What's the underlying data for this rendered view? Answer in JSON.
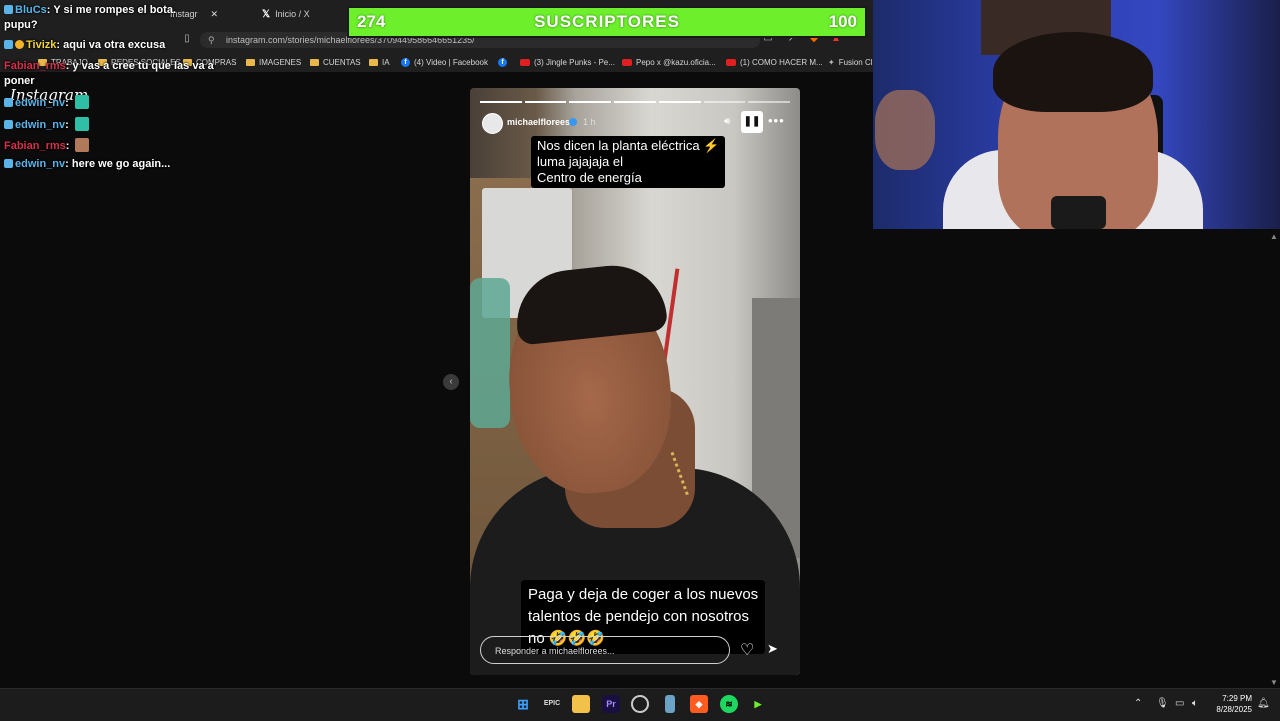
{
  "browser": {
    "tabs": [
      {
        "label": "Instagr"
      },
      {
        "label": "Inicio / X"
      }
    ],
    "url": "instagram.com/stories/michaelflorees/3709449586646651235/",
    "bookmarks": [
      {
        "label": "TRABAJO",
        "icon": "folder-icon"
      },
      {
        "label": "REDES SOCIALES",
        "icon": "folder-icon"
      },
      {
        "label": "COMPRAS",
        "icon": "folder-icon"
      },
      {
        "label": "IMAGENES",
        "icon": "folder-icon"
      },
      {
        "label": "CUENTAS",
        "icon": "folder-icon"
      },
      {
        "label": "IA",
        "icon": "folder-icon"
      },
      {
        "label": "(4) Video | Facebook",
        "icon": "facebook-icon"
      },
      {
        "label": "(3) Jingle Punks - Pe...",
        "icon": "youtube-icon"
      },
      {
        "label": "Pepo x @kazu.oficia...",
        "icon": "youtube-icon"
      },
      {
        "label": "(1) COMO HACER M...",
        "icon": "youtube-icon"
      },
      {
        "label": "Fusion Cl",
        "icon": "app-icon"
      }
    ]
  },
  "instagram": {
    "logo": "Instagram",
    "story": {
      "username": "michaelflorees",
      "time": "1 h",
      "caption_top": [
        "Nos dicen la planta eléctrica ⚡",
        "luma jajajaja el",
        "Centro de energía"
      ],
      "caption_bottom": [
        "Paga y deja  de coger a los nuevos",
        "talentos de pendejo con nosotros",
        "no 🤣🤣🤣"
      ],
      "reply_placeholder": "Responder a michaelflorees...",
      "progress_segments": 7,
      "progress_current": 5
    }
  },
  "chat": [
    {
      "user": "BluCs",
      "color": "#5ab4e8",
      "message": "Y si me rompes el bota."
    },
    {
      "user": "",
      "color": "#ffffff",
      "message": "pupu?"
    },
    {
      "user": "Tivizk",
      "color": "#f2d33a",
      "message": "aqui va otra excusa"
    },
    {
      "user": "Fabian_rms",
      "color": "#d6304a",
      "message": "y vas a cree tu que las va a"
    },
    {
      "user": "",
      "color": "#ffffff",
      "message": "poner"
    },
    {
      "user": "edwin_nv",
      "color": "#5ab4e8",
      "message": ""
    },
    {
      "user": "edwin_nv",
      "color": "#5ab4e8",
      "message": ""
    },
    {
      "user": "Fabian_rms",
      "color": "#d6304a",
      "message": ""
    },
    {
      "user": "edwin_nv",
      "color": "#5ab4e8",
      "message": "here we go again..."
    }
  ],
  "subscriber_bar": {
    "current": "274",
    "label": "SUSCRIPTORES",
    "goal": "100",
    "color": "#6df02b"
  },
  "taskbar": {
    "apps": [
      "windows-start-icon",
      "epic-games-icon",
      "file-explorer-icon",
      "premiere-pro-icon",
      "obs-icon",
      "notepad-icon",
      "brave-browser-icon",
      "spotify-icon",
      "app-icon"
    ],
    "time": "7:29 PM",
    "date": "8/28/2025"
  }
}
